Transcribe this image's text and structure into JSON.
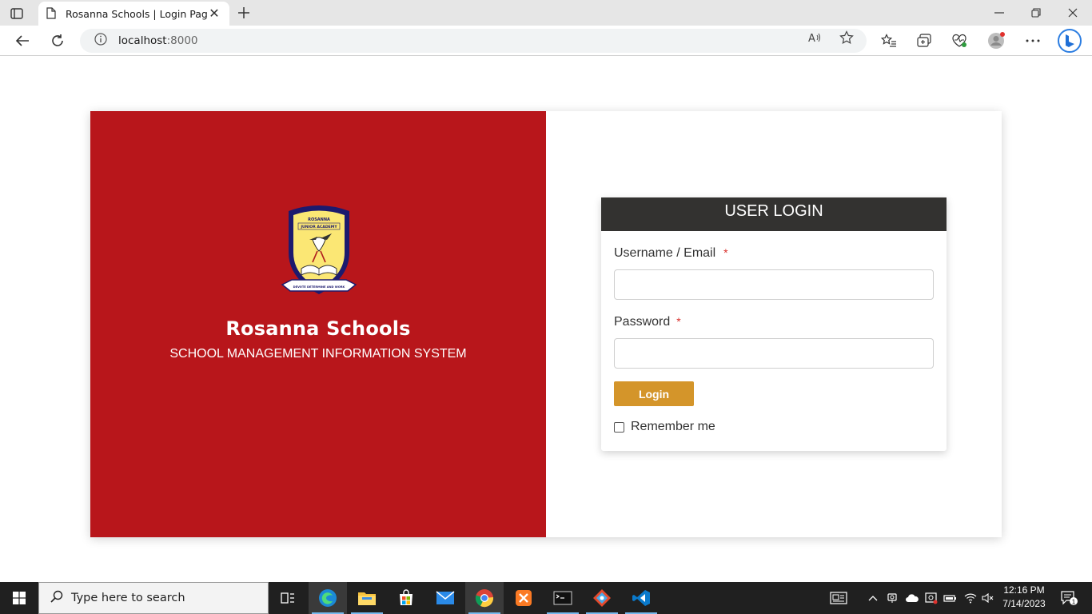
{
  "browser": {
    "tab_title": "Rosanna Schools | Login Page",
    "url_host": "localhost",
    "url_port": ":8000"
  },
  "brand": {
    "name": "Rosanna Schools",
    "subtitle": "SCHOOL MANAGEMENT INFORMATION SYSTEM",
    "logo_name": "ROSANNA",
    "logo_sub": "JUNIOR ACADEMY",
    "logo_motto": "DEVOTE DETERMINE AND WORK",
    "color": "#b8161b"
  },
  "login": {
    "header": "USER LOGIN",
    "username_label": "Username / Email",
    "password_label": "Password",
    "required_mark": "*",
    "username_value": "",
    "password_value": "",
    "button_label": "Login",
    "remember_label": "Remember me",
    "remember_checked": false,
    "button_color": "#d4952a",
    "header_color": "#333230"
  },
  "taskbar": {
    "search_placeholder": "Type here to search",
    "time": "12:16 PM",
    "date": "7/14/2023",
    "notification_count": "1"
  }
}
